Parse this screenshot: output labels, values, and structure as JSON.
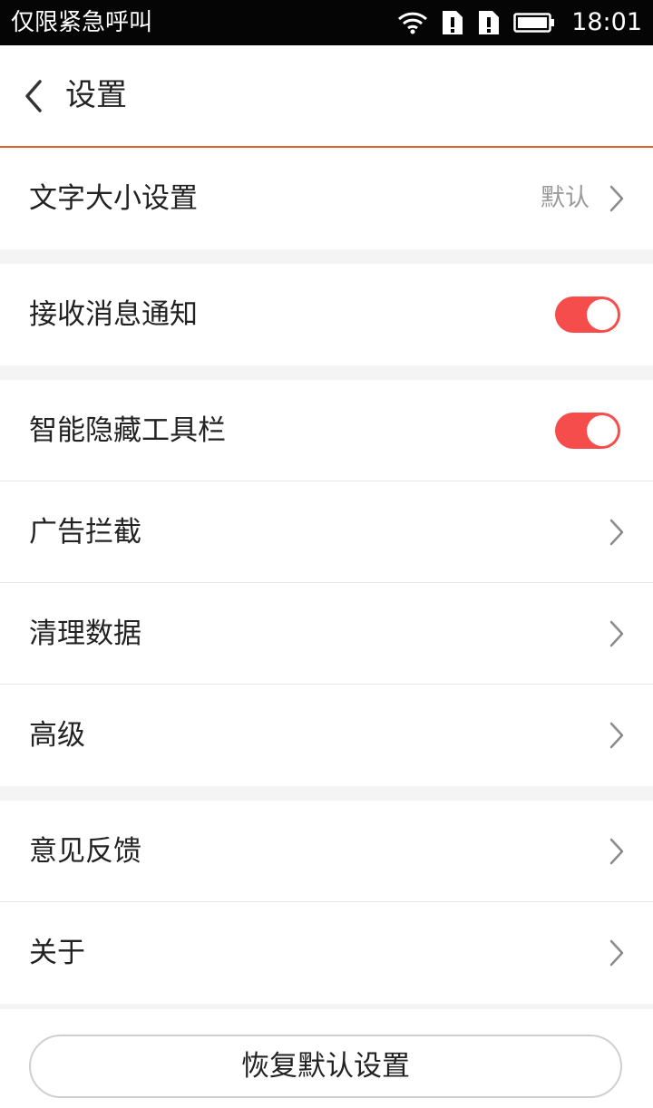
{
  "status_bar": {
    "carrier": "仅限紧急呼叫",
    "time": "18:01",
    "icons": [
      "wifi-icon",
      "sim-alert-icon",
      "sim-alert-icon",
      "battery-icon"
    ]
  },
  "header": {
    "title": "设置",
    "back_icon": "chevron-left-icon"
  },
  "groups": [
    {
      "items": [
        {
          "label": "文字大小设置",
          "value": "默认",
          "control": "chevron"
        }
      ]
    },
    {
      "items": [
        {
          "label": "接收消息通知",
          "control": "toggle",
          "on": true
        }
      ]
    },
    {
      "items": [
        {
          "label": "智能隐藏工具栏",
          "control": "toggle",
          "on": true
        },
        {
          "label": "广告拦截",
          "control": "chevron"
        },
        {
          "label": "清理数据",
          "control": "chevron"
        },
        {
          "label": "高级",
          "control": "chevron"
        }
      ]
    },
    {
      "items": [
        {
          "label": "意见反馈",
          "control": "chevron"
        },
        {
          "label": "关于",
          "control": "chevron"
        }
      ]
    }
  ],
  "reset_button": {
    "label": "恢复默认设置"
  },
  "colors": {
    "accent_line": "#e0602e",
    "toggle_on": "#f54c4c",
    "status_bar_bg": "#050505",
    "group_gap": "#f4f4f4"
  }
}
